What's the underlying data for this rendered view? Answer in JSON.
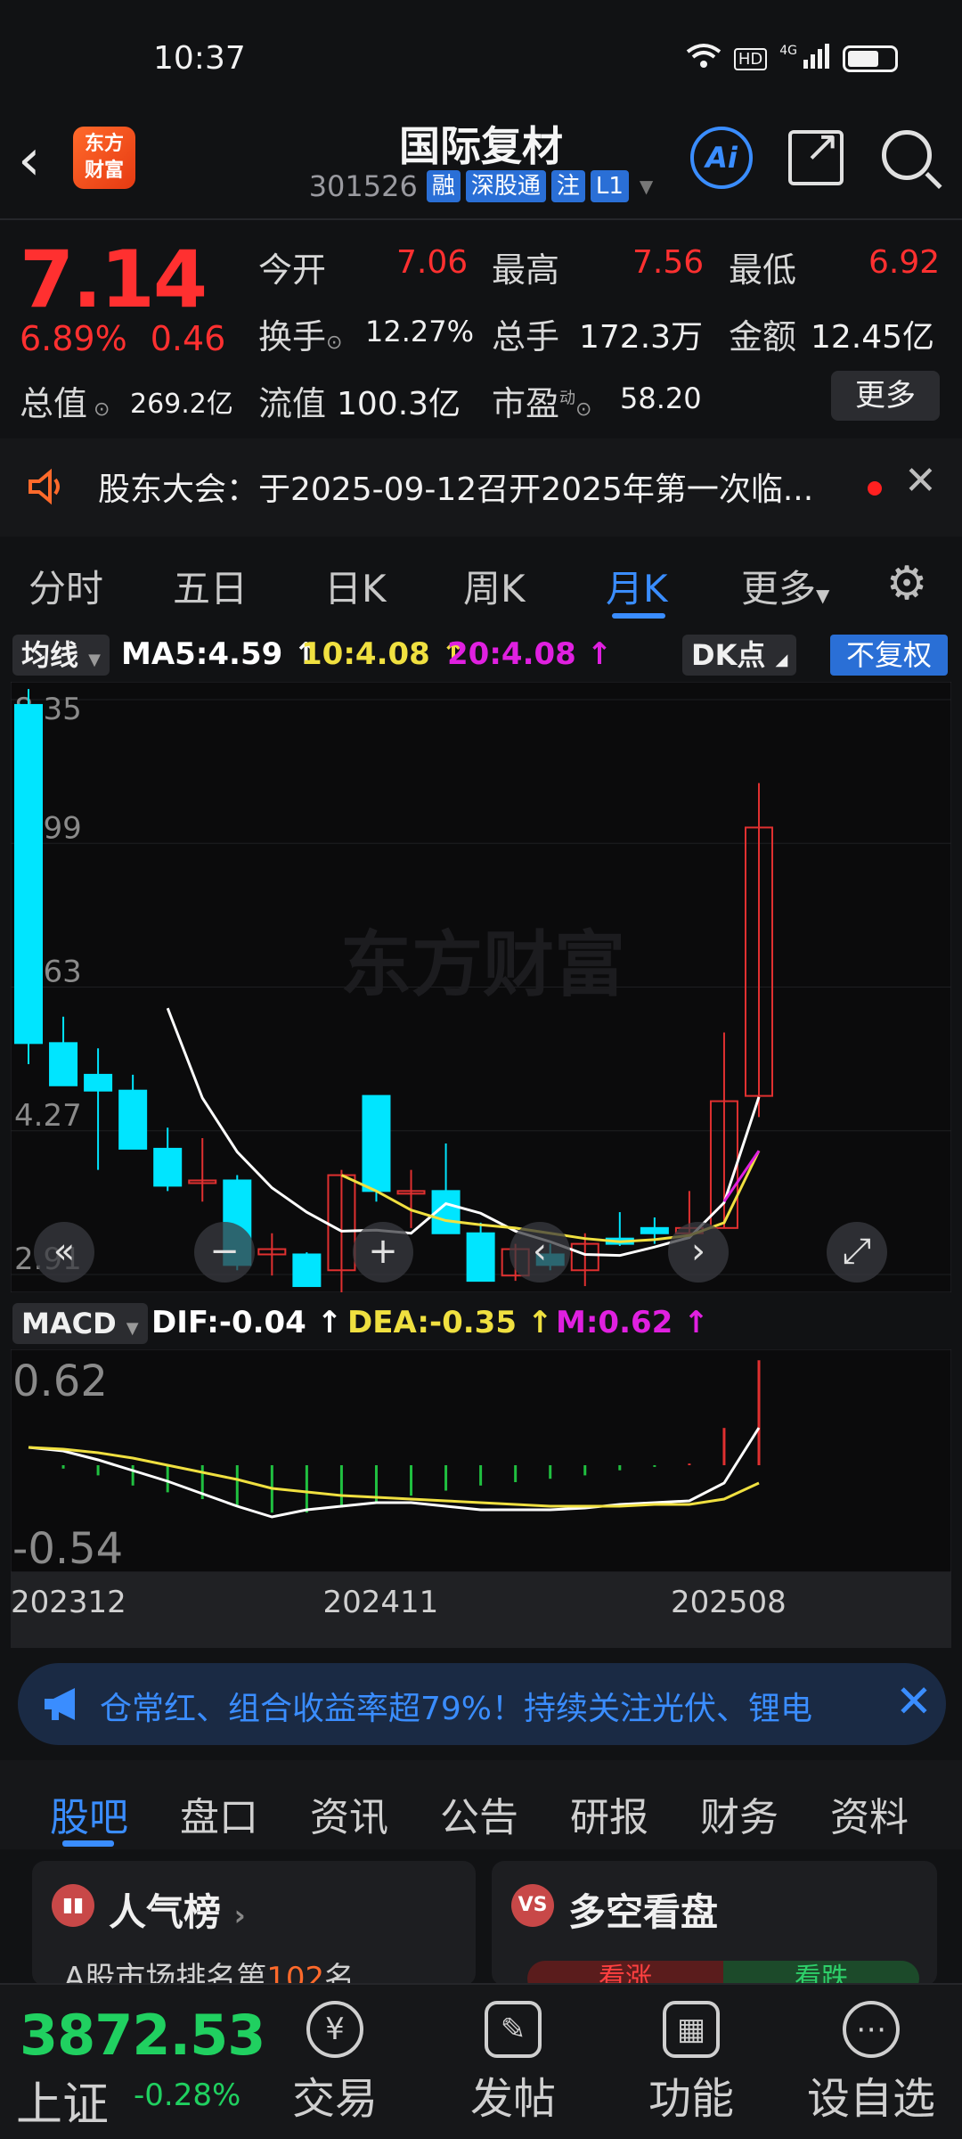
{
  "status": {
    "time": "10:37",
    "net": "HD",
    "signal": "4G"
  },
  "header": {
    "logo_text": "东方\n财富",
    "title": "国际复材",
    "code": "301526",
    "tags": [
      "融",
      "深股通",
      "注",
      "L1"
    ]
  },
  "quote": {
    "price": "7.14",
    "change_pct": "6.89%",
    "change_abs": "0.46",
    "open_label": "今开",
    "open": "7.06",
    "high_label": "最高",
    "high": "7.56",
    "low_label": "最低",
    "low": "6.92",
    "turnover_label": "换手",
    "turnover": "12.27%",
    "volume_label": "总手",
    "volume": "172.3万",
    "amount_label": "金额",
    "amount": "12.45亿",
    "mktcap_label": "总值",
    "mktcap": "269.2亿",
    "float_label": "流值",
    "float": "100.3亿",
    "pe_label": "市盈",
    "pe_sup": "动",
    "pe": "58.20",
    "more_label": "更多"
  },
  "notice": {
    "text": "股东大会：于2025-09-12召开2025年第一次临..."
  },
  "period_tabs": [
    "分时",
    "五日",
    "日K",
    "周K",
    "月K",
    "更多"
  ],
  "active_period": "月K",
  "ma": {
    "selector": "均线",
    "ma5": "MA5:4.59",
    "ma10": "10:4.08",
    "ma20": "20:4.08",
    "dk_label": "DK点",
    "adjust_label": "不复权",
    "colors": {
      "ma5": "#ffffff",
      "ma10": "#f0e040",
      "ma20": "#e020e0"
    }
  },
  "watermark": "东方财富",
  "chart_data": [
    {
      "type": "candlestick",
      "title": "",
      "y_ticks": [
        "8.35",
        "6.99",
        "5.63",
        "4.27",
        "2.91"
      ],
      "ylim": [
        2.91,
        8.35
      ],
      "candles": [
        {
          "o": 8.3,
          "h": 8.45,
          "l": 4.9,
          "c": 5.1
        },
        {
          "o": 5.1,
          "h": 5.35,
          "l": 4.75,
          "c": 4.7
        },
        {
          "o": 4.8,
          "h": 5.05,
          "l": 3.9,
          "c": 4.65
        },
        {
          "o": 4.65,
          "h": 4.8,
          "l": 4.2,
          "c": 4.1
        },
        {
          "o": 4.1,
          "h": 4.3,
          "l": 3.7,
          "c": 3.75
        },
        {
          "o": 3.8,
          "h": 4.2,
          "l": 3.6,
          "c": 3.8
        },
        {
          "o": 3.8,
          "h": 3.85,
          "l": 2.95,
          "c": 3.0
        },
        {
          "o": 3.1,
          "h": 3.3,
          "l": 2.9,
          "c": 3.15
        },
        {
          "o": 3.1,
          "h": 3.12,
          "l": 2.8,
          "c": 2.8
        },
        {
          "o": 2.95,
          "h": 3.9,
          "l": 2.7,
          "c": 3.85
        },
        {
          "o": 4.6,
          "h": 4.6,
          "l": 3.6,
          "c": 3.7
        },
        {
          "o": 3.7,
          "h": 3.9,
          "l": 3.35,
          "c": 3.7
        },
        {
          "o": 3.7,
          "h": 4.15,
          "l": 3.3,
          "c": 3.3
        },
        {
          "o": 3.3,
          "h": 3.4,
          "l": 2.85,
          "c": 2.85
        },
        {
          "o": 2.9,
          "h": 3.2,
          "l": 2.85,
          "c": 3.15
        },
        {
          "o": 3.1,
          "h": 3.2,
          "l": 2.95,
          "c": 3.0
        },
        {
          "o": 2.95,
          "h": 3.3,
          "l": 2.8,
          "c": 3.2
        },
        {
          "o": 3.25,
          "h": 3.5,
          "l": 3.18,
          "c": 3.2
        },
        {
          "o": 3.35,
          "h": 3.45,
          "l": 3.2,
          "c": 3.3
        },
        {
          "o": 3.3,
          "h": 3.7,
          "l": 3.28,
          "c": 3.35
        },
        {
          "o": 3.35,
          "h": 5.2,
          "l": 3.35,
          "c": 4.55
        },
        {
          "o": 4.6,
          "h": 7.56,
          "l": 4.4,
          "c": 7.14
        }
      ],
      "ma5": [
        null,
        null,
        null,
        null,
        5.43,
        4.58,
        4.07,
        3.73,
        3.5,
        3.32,
        3.33,
        3.3,
        3.58,
        3.49,
        3.32,
        3.22,
        3.1,
        3.09,
        3.17,
        3.26,
        3.59,
        4.59
      ],
      "ma10": [
        null,
        null,
        null,
        null,
        null,
        null,
        null,
        null,
        null,
        3.85,
        3.7,
        3.52,
        3.42,
        3.38,
        3.35,
        3.3,
        3.25,
        3.22,
        3.24,
        3.28,
        3.4,
        4.08
      ],
      "ma20": [
        null,
        null,
        null,
        null,
        null,
        null,
        null,
        null,
        null,
        null,
        null,
        null,
        null,
        null,
        null,
        null,
        null,
        null,
        null,
        null,
        3.6,
        4.08
      ]
    },
    {
      "type": "bar",
      "title": "",
      "indicator": "MACD",
      "dif_label": "DIF:-0.04",
      "dea_label": "DEA:-0.35",
      "m_label": "M:0.62",
      "y_ticks": [
        "0.62",
        "-0.54"
      ],
      "ylim": [
        -0.54,
        0.62
      ],
      "histogram": [
        0.0,
        -0.02,
        -0.06,
        -0.12,
        -0.16,
        -0.2,
        -0.24,
        -0.28,
        -0.28,
        -0.25,
        -0.22,
        -0.18,
        -0.15,
        -0.12,
        -0.1,
        -0.08,
        -0.06,
        -0.03,
        -0.01,
        0.01,
        0.22,
        0.62
      ],
      "dif": [
        -0.15,
        -0.17,
        -0.22,
        -0.28,
        -0.34,
        -0.41,
        -0.48,
        -0.54,
        -0.5,
        -0.48,
        -0.46,
        -0.46,
        -0.48,
        -0.5,
        -0.5,
        -0.5,
        -0.49,
        -0.47,
        -0.46,
        -0.45,
        -0.35,
        -0.04
      ],
      "dea": [
        -0.15,
        -0.16,
        -0.18,
        -0.21,
        -0.25,
        -0.29,
        -0.33,
        -0.38,
        -0.4,
        -0.42,
        -0.43,
        -0.44,
        -0.45,
        -0.46,
        -0.47,
        -0.48,
        -0.48,
        -0.48,
        -0.47,
        -0.47,
        -0.44,
        -0.35
      ],
      "x_ticks": [
        {
          "i": 0,
          "label": "202312"
        },
        {
          "i": 10,
          "label": "202411"
        },
        {
          "i": 20,
          "label": "202508"
        }
      ]
    }
  ],
  "ticker": {
    "text": "仓常红、组合收益率超79%！持续关注光伏、锂电"
  },
  "info_tabs": [
    "股吧",
    "盘口",
    "资讯",
    "公告",
    "研报",
    "财务",
    "资料"
  ],
  "cards": {
    "popular_title": "人气榜",
    "popular_sub_prefix": "A股市场排名第",
    "popular_rank": "102",
    "popular_sub_suffix": "名",
    "vs_title": "多空看盘",
    "vs_up": "看涨",
    "vs_down": "看跌"
  },
  "bottom": {
    "index_value": "3872.53",
    "index_name": "上证",
    "index_change": "-0.28%",
    "nav": [
      "交易",
      "发帖",
      "功能",
      "设自选"
    ]
  }
}
